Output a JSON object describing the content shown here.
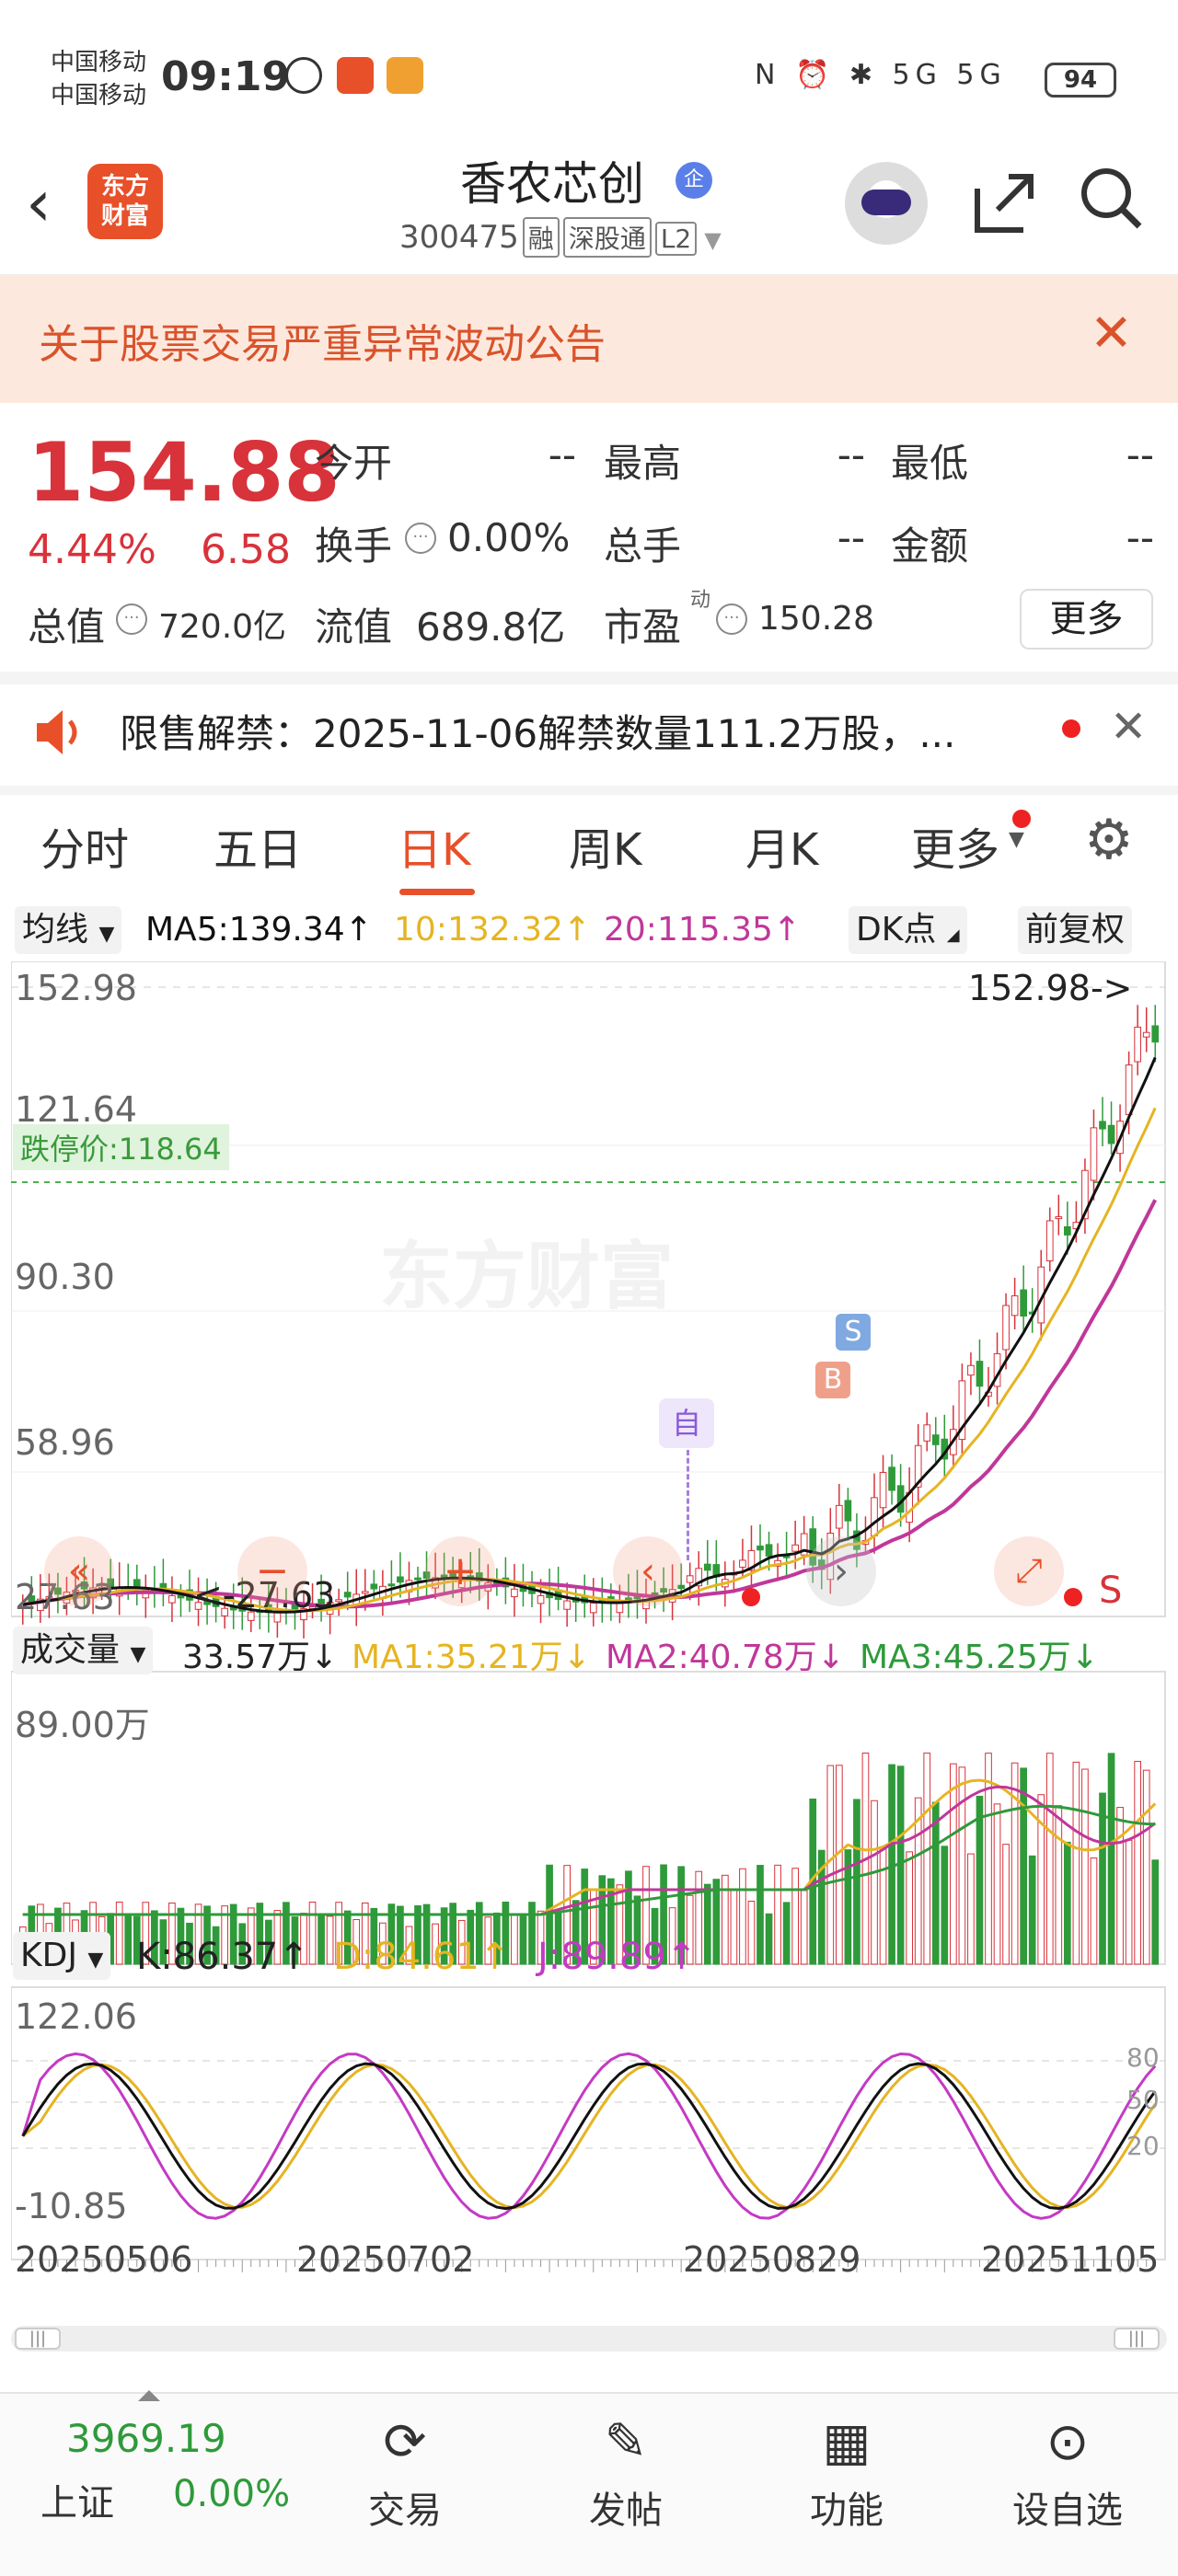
{
  "status": {
    "carrier1": "中国移动",
    "carrier2": "中国移动",
    "time": "09:19",
    "battery": "94",
    "signals": "N ⏰ ✱ 5G 5G"
  },
  "header": {
    "logo": "东方\n财富",
    "title": "香农芯创",
    "qi_badge": "企",
    "code": "300475",
    "tags": [
      "融",
      "深股通",
      "L2"
    ]
  },
  "notice": {
    "text": "关于股票交易严重异常波动公告",
    "close": "✕"
  },
  "quote": {
    "price": "154.88",
    "pct": "4.44%",
    "change": "6.58",
    "open_label": "今开",
    "open": "--",
    "high_label": "最高",
    "high": "--",
    "low_label": "最低",
    "low": "--",
    "turnover_label": "换手",
    "turnover": "0.00%",
    "volume_label": "总手",
    "volume": "--",
    "amount_label": "金额",
    "amount": "--",
    "mktcap_label": "总值",
    "mktcap": "720.0亿",
    "float_label": "流值",
    "float": "689.8亿",
    "pe_label": "市盈",
    "pe_sup": "动",
    "pe": "150.28",
    "more": "更多"
  },
  "unlock": {
    "text": "限售解禁：2025-11-06解禁数量111.2万股，..."
  },
  "tabs": [
    "分时",
    "五日",
    "日K",
    "周K",
    "月K",
    "更多"
  ],
  "ma_bar": {
    "label": "均线",
    "ma5": "MA5:139.34↑",
    "ma10": "10:132.32↑",
    "ma20": "20:115.35↑",
    "dk": "DK点",
    "fq": "前复权"
  },
  "price_axis": {
    "p1": "152.98",
    "p2": "121.64",
    "p3": "90.30",
    "p4": "58.96",
    "p5": "27.63",
    "limit_down": "跌停价:118.64",
    "max_label": "152.98->",
    "min_label": "<-27.63",
    "watermark": "东方财富",
    "marker_zi": "自",
    "marker_b": "B",
    "marker_s": "S",
    "marker_s2": "S"
  },
  "volume": {
    "label": "成交量",
    "v": "33.57万↓",
    "ma1": "MA1:35.21万↓",
    "ma2": "MA2:40.78万↓",
    "ma3": "MA3:45.25万↓",
    "axis_top": "89.00万"
  },
  "kdj": {
    "label": "KDJ",
    "k": "K:86.37↑",
    "d": "D:84.61↑",
    "j": "J:89.89↑",
    "top": "122.06",
    "bottom": "-10.85",
    "l80": "80",
    "l50": "50",
    "l20": "20"
  },
  "dates": [
    "20250506",
    "20250702",
    "20250829",
    "20251105"
  ],
  "bottom_nav": {
    "index_value": "3969.19",
    "index_name": "上证",
    "index_change": "0.00%",
    "items": [
      "交易",
      "发帖",
      "功能",
      "设自选"
    ]
  },
  "colors": {
    "up": "#d8323a",
    "down": "#2e9a3a",
    "ma5": "#111111",
    "ma10": "#e6b422",
    "ma20": "#c0379a",
    "accent": "#e8502a"
  }
}
